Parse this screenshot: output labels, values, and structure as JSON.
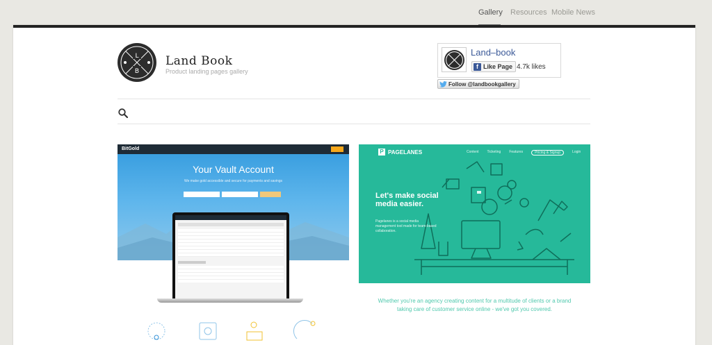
{
  "nav": {
    "items": [
      {
        "label": "Gallery"
      },
      {
        "label": "Resources"
      },
      {
        "label": "Mobile News"
      }
    ]
  },
  "header": {
    "logo_letters": [
      "L",
      "B"
    ],
    "title": "Land Book",
    "subtitle": "Product landing pages gallery"
  },
  "facebook": {
    "page_name": "Land–book",
    "like_label": "Like Page",
    "likes": "4.7k likes"
  },
  "twitter": {
    "follow_label": "Follow @landbookgallery"
  },
  "gallery": [
    {
      "site": "BitGold",
      "hero_title": "Your Vault Account",
      "hero_sub": "We make gold accessible and secure for payments and savings"
    },
    {
      "site": "PAGELANES",
      "nav": [
        "Content",
        "Ticketing",
        "Features",
        "Pricing & Signup",
        "Login"
      ],
      "headline": "Let's make social media easier.",
      "body": "Pagelanes is a social media management tool made for team-based collaboration.",
      "description": "Whether you're an agency creating content for a multitude of clients or a brand taking care of customer service online - we've got you covered."
    }
  ],
  "colors": {
    "accent_dark": "#222222",
    "facebook_blue": "#3b5998",
    "pagelanes_green": "#26b99a",
    "bitgold_blue": "#3a9fe0"
  }
}
